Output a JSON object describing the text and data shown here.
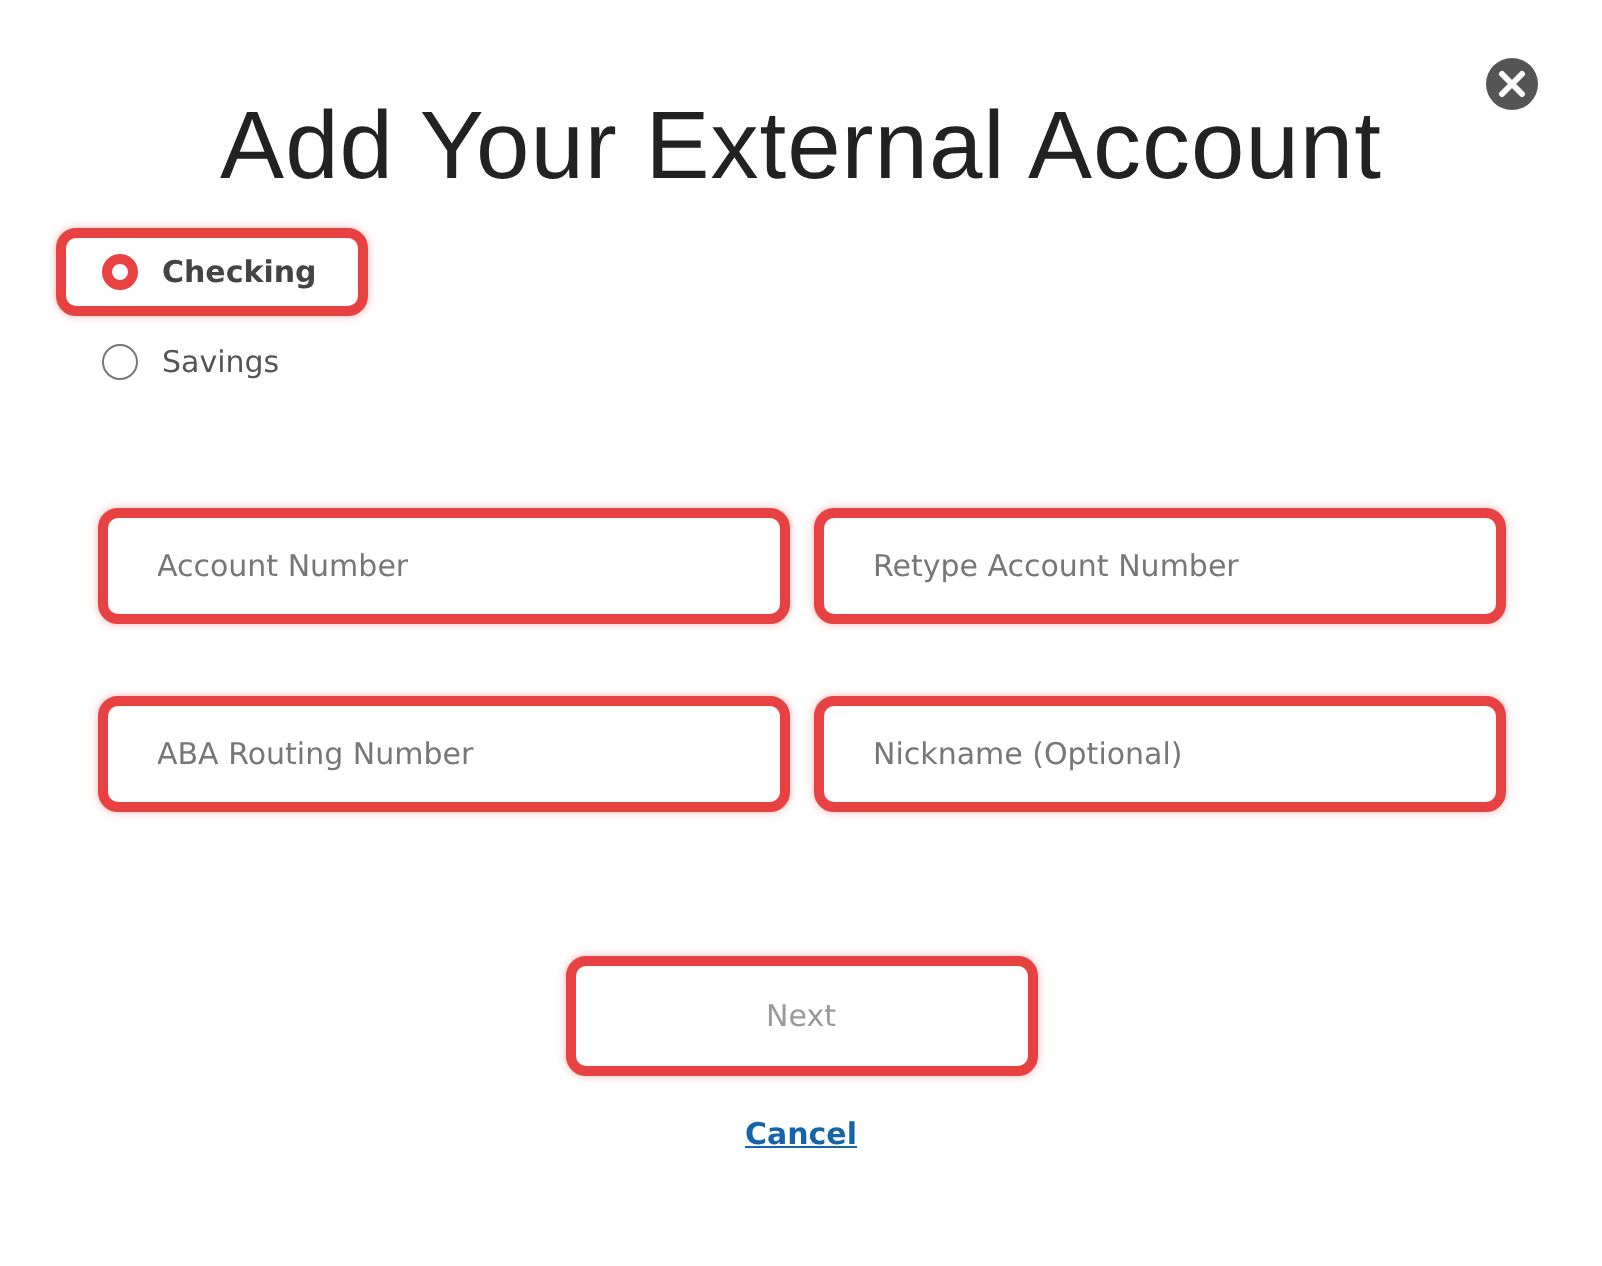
{
  "dialog": {
    "title": "Add Your External Account"
  },
  "account_types": [
    {
      "label": "Checking",
      "selected": true,
      "highlighted": true
    },
    {
      "label": "Savings",
      "selected": false,
      "highlighted": false
    }
  ],
  "fields": [
    {
      "placeholder": "Account Number"
    },
    {
      "placeholder": "Retype Account Number"
    },
    {
      "placeholder": "ABA Routing Number"
    },
    {
      "placeholder": "Nickname (Optional)"
    }
  ],
  "next_button": {
    "label": "Next",
    "disabled": true
  },
  "cancel_link": "Cancel"
}
